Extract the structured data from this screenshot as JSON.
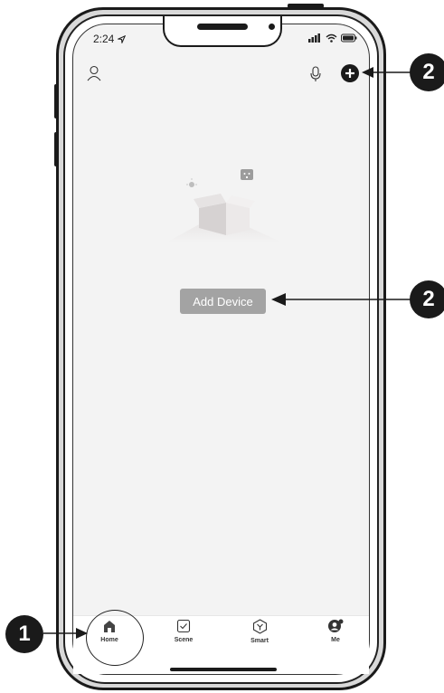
{
  "status_bar": {
    "time": "2:24",
    "location_arrow": "location-arrow-icon"
  },
  "header": {
    "profile_icon": "user-icon",
    "mic_icon": "microphone-icon",
    "add_icon": "plus-circle-icon"
  },
  "main": {
    "empty_illustration": "empty-box-illustration",
    "add_device_label": "Add Device"
  },
  "tabbar": {
    "tabs": [
      {
        "label": "Home",
        "icon": "home-icon",
        "selected": true
      },
      {
        "label": "Scene",
        "icon": "checkbox-icon",
        "selected": false
      },
      {
        "label": "Smart",
        "icon": "cube-icon",
        "selected": false
      },
      {
        "label": "Me",
        "icon": "person-gear-icon",
        "selected": false
      }
    ]
  },
  "callouts": [
    {
      "number": "2",
      "target": "add-button"
    },
    {
      "number": "2",
      "target": "add-device-button"
    },
    {
      "number": "1",
      "target": "tab-home"
    }
  ],
  "colors": {
    "screen_bg": "#f3f3f3",
    "button_bg": "#a3a3a3",
    "frame": "#1a1a1a",
    "badge": "#1a1a1a"
  }
}
